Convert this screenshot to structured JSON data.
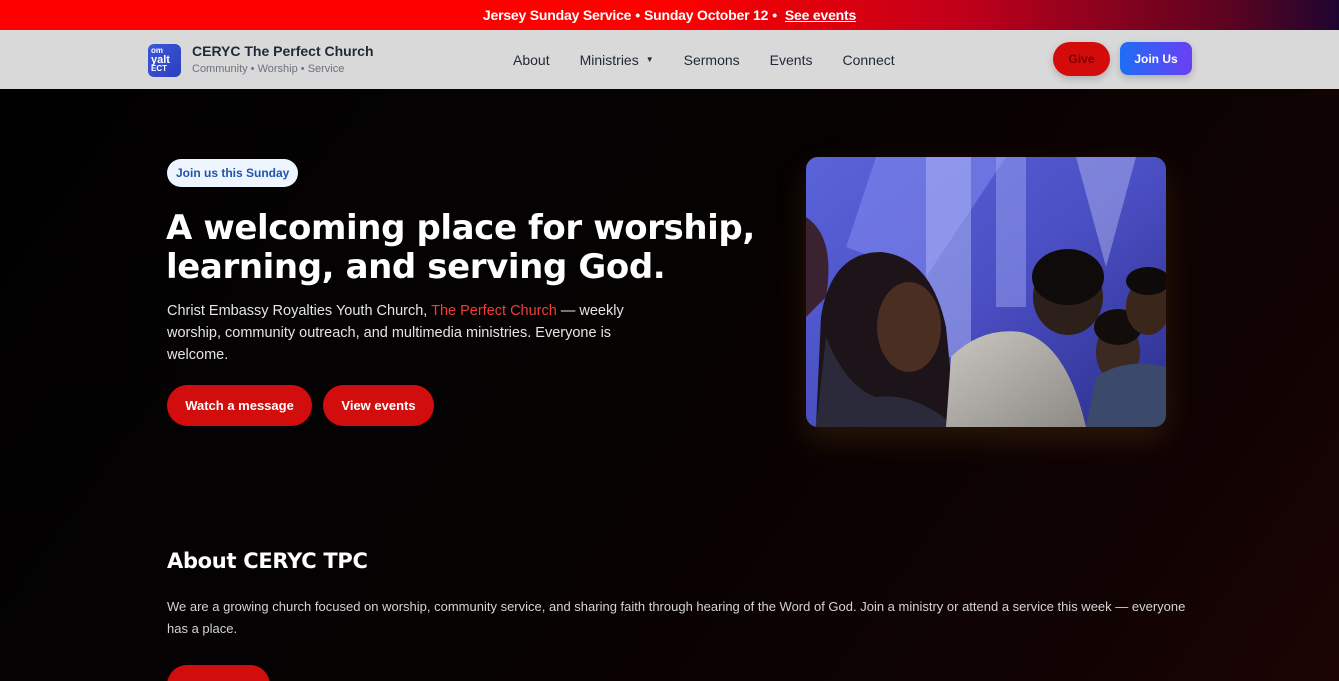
{
  "announcement": {
    "text": "Jersey Sunday Service",
    "separator": "•",
    "date": "Sunday October 12",
    "separator2": "•",
    "link": "See events"
  },
  "nav": {
    "logo_lines": [
      "om",
      "yalt",
      "ECT"
    ],
    "brand_title": "CERYC The Perfect Church",
    "brand_subtitle": "Community • Worship • Service",
    "items": [
      {
        "label": "About"
      },
      {
        "label": "Ministries",
        "has_dropdown": true
      },
      {
        "label": "Sermons"
      },
      {
        "label": "Events"
      },
      {
        "label": "Connect"
      }
    ],
    "caret": "▼",
    "give_label": "Give",
    "join_label": "Join Us"
  },
  "hero": {
    "pill": "Join us this Sunday",
    "title": "A welcoming place for worship, learning, and serving God.",
    "desc_before": "Christ Embassy Royalties Youth Church, ",
    "desc_highlight": "The Perfect Church",
    "desc_after": " — weekly worship, community outreach, and multimedia ministries. Everyone is welcome.",
    "watch_label": "Watch a message",
    "events_label": "View events",
    "image_alt": "worship photo"
  },
  "about": {
    "title": "About CERYC TPC",
    "text": "We are a growing church focused on worship, community service, and sharing faith through hearing of the Word of God. Join a ministry or attend a service this week — everyone has a place."
  },
  "colors": {
    "brand_red": "#d10d0d",
    "highlight_red": "#f23c3c",
    "join_gradient_start": "#1e6ef5",
    "join_gradient_end": "#6a3ff5",
    "nav_bg": "#d9d9d9"
  }
}
